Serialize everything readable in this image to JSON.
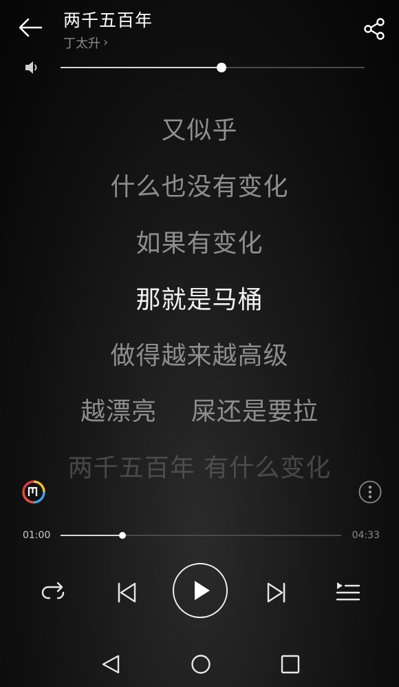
{
  "header": {
    "song_title": "两千五百年",
    "artist": "丁太升",
    "artist_chevron": "›",
    "back_icon": "arrow-left-icon",
    "share_icon": "share-icon"
  },
  "volume": {
    "icon": "speaker-icon",
    "level": 0.53
  },
  "lyrics": [
    "又似乎",
    "什么也没有变化",
    "如果有变化",
    "那就是马桶",
    "做得越来越高级",
    "越漂亮    屎还是要拉",
    "两千五百年 有什么变化"
  ],
  "current_lyric_index": 3,
  "player": {
    "app_logo_icon": "music-app-logo-icon",
    "more_icon": "more-vertical-icon",
    "elapsed": "01:00",
    "total": "04:33",
    "progress": 0.22
  },
  "controls": {
    "repeat_icon": "repeat-icon",
    "prev_icon": "skip-previous-icon",
    "play_icon": "play-icon",
    "next_icon": "skip-next-icon",
    "playlist_icon": "playlist-icon"
  },
  "navbar": {
    "back_icon": "nav-back-triangle-icon",
    "home_icon": "nav-home-circle-icon",
    "recent_icon": "nav-recents-square-icon"
  },
  "colors": {
    "text_primary": "#ffffff",
    "text_secondary": "#8a8a8a",
    "lyric_inactive": "#8e8e8e",
    "lyric_active": "#f2f2f2",
    "track": "#4a4a4a",
    "track_fill": "#d8d8d8"
  }
}
